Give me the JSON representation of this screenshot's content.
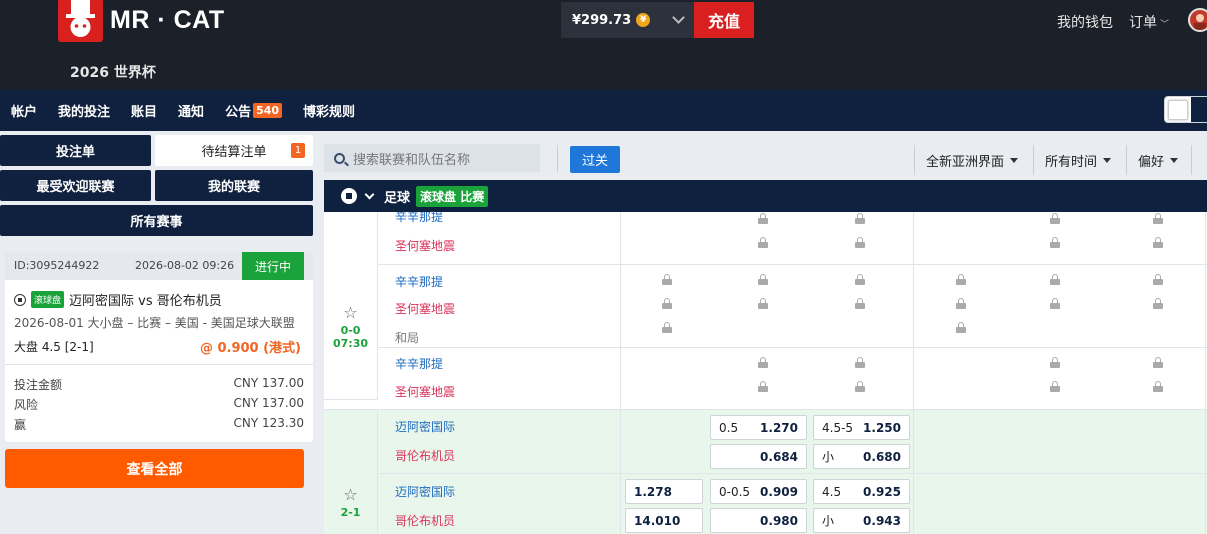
{
  "header": {
    "brand": "MR · CAT",
    "subtitle": "2026 世界杯",
    "balance": "¥299.73",
    "coin": "¥",
    "topup": "充值",
    "wallet": "我的钱包",
    "orders": "订单"
  },
  "nav": {
    "items": [
      "帐户",
      "我的投注",
      "账目",
      "通知",
      "公告",
      "博彩规则"
    ],
    "notice_badge": "540"
  },
  "left": {
    "betslip": "投注单",
    "pending": "待结算注单",
    "pending_count": "1",
    "popular": "最受欢迎联赛",
    "my_leagues": "我的联赛",
    "all_events": "所有赛事",
    "card": {
      "id": "ID:3095244922",
      "datetime": "2026-08-02  09:26",
      "status": "进行中",
      "live_tag": "滚球盘",
      "match": "迈阿密国际 vs 哥伦布机员",
      "league": "2026-08-01 大小盘 – 比赛 – 美国 - 美国足球大联盟",
      "selection": "大盘 4.5 [2-1]",
      "odds": "@ 0.900 (港式)",
      "stake_label": "投注金额",
      "stake_value": "CNY 137.00",
      "risk_label": "风险",
      "risk_value": "CNY 137.00",
      "win_label": "赢",
      "win_value": "CNY 123.30"
    },
    "view_all": "查看全部"
  },
  "filter": {
    "search_placeholder": "搜索联赛和队伍名称",
    "pass_button": "过关",
    "view": "全新亚洲界面",
    "time": "所有时间",
    "pref": "偏好"
  },
  "sport_header": {
    "sport": "足球",
    "tag": "滚球盘 比赛"
  },
  "matches": [
    {
      "home": "辛辛那提",
      "away": "圣何塞地震"
    },
    {
      "home": "辛辛那提",
      "away": "圣何塞地震",
      "draw": "和局",
      "score": "0-0",
      "time": "07:30"
    },
    {
      "home": "辛辛那提",
      "away": "圣何塞地震"
    },
    {
      "home": "迈阿密国际",
      "away": "哥伦布机员",
      "hdp_home_line": "0.5",
      "hdp_home_price": "1.270",
      "hdp_away_price": "0.684",
      "ou_over_line": "4.5-5",
      "ou_over_price": "1.250",
      "ou_under_label": "小",
      "ou_under_price": "0.680"
    },
    {
      "home": "迈阿密国际",
      "away": "哥伦布机员",
      "score": "2-1",
      "x12_home": "1.278",
      "x12_away": "14.010",
      "hdp_home_line": "0-0.5",
      "hdp_home_price": "0.909",
      "hdp_away_price": "0.980",
      "ou_over_line": "4.5",
      "ou_over_price": "0.925",
      "ou_under_label": "小",
      "ou_under_price": "0.943"
    }
  ]
}
